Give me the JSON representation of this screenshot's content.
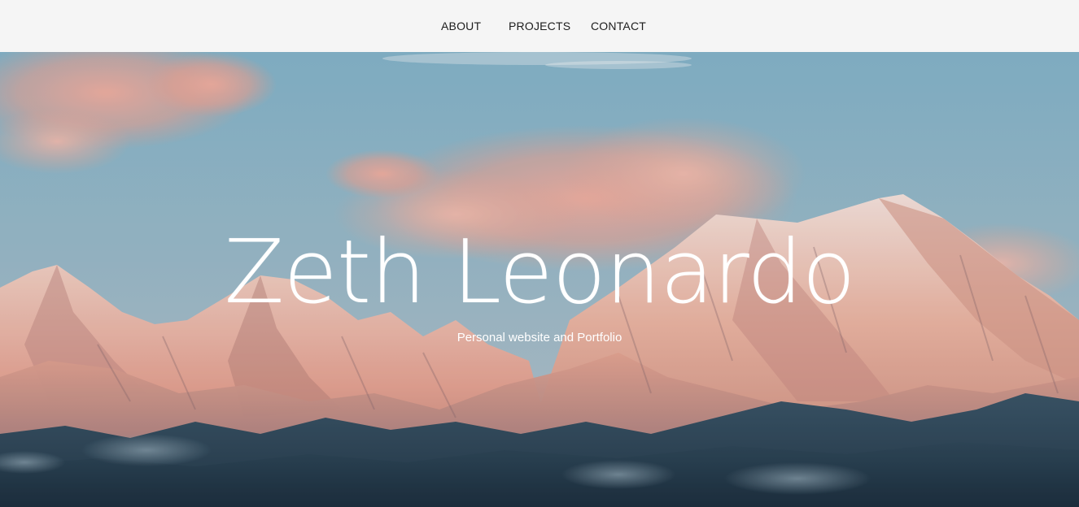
{
  "nav": {
    "items": [
      {
        "label": "ABOUT"
      },
      {
        "label": "PROJECTS"
      },
      {
        "label": "CONTACT"
      }
    ]
  },
  "hero": {
    "title": "Zeth Leonardo",
    "subtitle": "Personal website and Portfolio",
    "background": "mountain-sunrise-photo"
  },
  "colors": {
    "navbar_bg": "#f5f5f5",
    "nav_text": "#1c1c1c",
    "hero_text": "#ffffff",
    "sky": "#7fb0c8",
    "cloud_pink": "#f2a99a",
    "snow_peach": "#f1b8a4",
    "mountain_dark": "#2f4a5e"
  }
}
